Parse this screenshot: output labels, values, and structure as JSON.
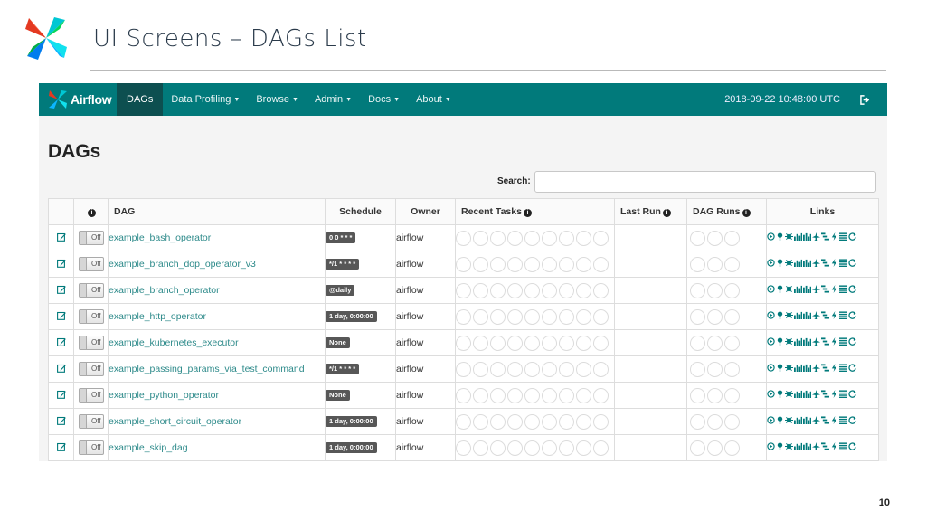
{
  "slide": {
    "title": "UI Screens – DAGs List",
    "page_number": "10"
  },
  "navbar": {
    "brand": "Airflow",
    "items": [
      {
        "label": "DAGs",
        "active": true,
        "dropdown": false
      },
      {
        "label": "Data Profiling",
        "active": false,
        "dropdown": true
      },
      {
        "label": "Browse",
        "active": false,
        "dropdown": true
      },
      {
        "label": "Admin",
        "active": false,
        "dropdown": true
      },
      {
        "label": "Docs",
        "active": false,
        "dropdown": true
      },
      {
        "label": "About",
        "active": false,
        "dropdown": true
      }
    ],
    "datetime": "2018-09-22 10:48:00 UTC",
    "logout_icon": "sign-out-icon",
    "color": "#017a7b",
    "active_color": "#0d4f50"
  },
  "page": {
    "heading": "DAGs",
    "search_label": "Search:",
    "search_value": ""
  },
  "table": {
    "headers": {
      "info": "i",
      "dag": "DAG",
      "schedule": "Schedule",
      "owner": "Owner",
      "recent_tasks": "Recent Tasks",
      "last_run": "Last Run",
      "dag_runs": "DAG Runs",
      "links": "Links"
    },
    "rows": [
      {
        "toggle": "Off",
        "name": "example_bash_operator",
        "schedule": "0 0 * * *",
        "owner": "airflow"
      },
      {
        "toggle": "Off",
        "name": "example_branch_dop_operator_v3",
        "schedule": "*/1 * * * *",
        "owner": "airflow"
      },
      {
        "toggle": "Off",
        "name": "example_branch_operator",
        "schedule": "@daily",
        "owner": "airflow"
      },
      {
        "toggle": "Off",
        "name": "example_http_operator",
        "schedule": "1 day, 0:00:00",
        "owner": "airflow"
      },
      {
        "toggle": "Off",
        "name": "example_kubernetes_executor",
        "schedule": "None",
        "owner": "airflow"
      },
      {
        "toggle": "Off",
        "name": "example_passing_params_via_test_command",
        "schedule": "*/1 * * * *",
        "owner": "airflow"
      },
      {
        "toggle": "Off",
        "name": "example_python_operator",
        "schedule": "None",
        "owner": "airflow"
      },
      {
        "toggle": "Off",
        "name": "example_short_circuit_operator",
        "schedule": "1 day, 0:00:00",
        "owner": "airflow"
      },
      {
        "toggle": "Off",
        "name": "example_skip_dag",
        "schedule": "1 day, 0:00:00",
        "owner": "airflow"
      }
    ],
    "link_icons": [
      "trigger-dag-icon",
      "tree-view-icon",
      "graph-view-icon",
      "task-duration-icon",
      "task-tries-icon",
      "landing-times-icon",
      "gantt-icon",
      "code-view-icon",
      "logs-icon",
      "refresh-icon"
    ]
  }
}
